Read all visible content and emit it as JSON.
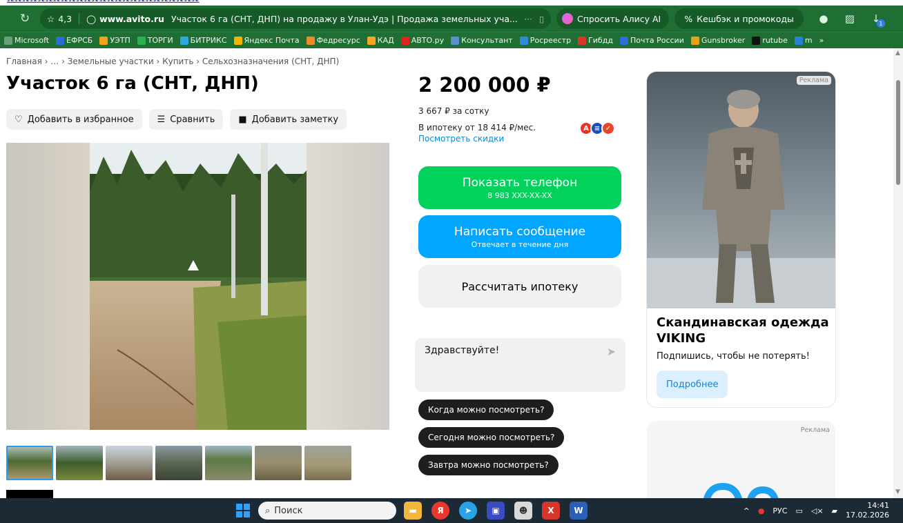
{
  "top_strip": {
    "text": "xxxxxxxxxxxxxxxxxxxxxxxxx"
  },
  "browser": {
    "rating": "4,3",
    "domain": "www.avito.ru",
    "tab_title": "Участок 6 га (СНТ, ДНП) на продажу в Улан-Удэ | Продажа земельных уча...",
    "more": "···",
    "alisa_label": "Спросить Алису AI",
    "cashback_label": "Кешбэк и промокоды",
    "download_badge": "1"
  },
  "bookmarks": [
    {
      "label": "Microsoft",
      "color": "#6b9f77"
    },
    {
      "label": "ЕФРСБ",
      "color": "#2f6bd6"
    },
    {
      "label": "УЭТП",
      "color": "#f3a31b"
    },
    {
      "label": "ТОРГИ",
      "color": "#2bb24c"
    },
    {
      "label": "БИТРИКС",
      "color": "#2aa8e0"
    },
    {
      "label": "Яндекс Почта",
      "color": "#f5b400"
    },
    {
      "label": "Федресурс",
      "color": "#f08a24"
    },
    {
      "label": "КАД",
      "color": "#f5a623"
    },
    {
      "label": "АВТО.ру",
      "color": "#e2231a"
    },
    {
      "label": "Консультант",
      "color": "#5a8fd8"
    },
    {
      "label": "Росреестр",
      "color": "#2f8ad8"
    },
    {
      "label": "Гибдд",
      "color": "#d8352a"
    },
    {
      "label": "Почта России",
      "color": "#2a6fd6"
    },
    {
      "label": "Gunsbroker",
      "color": "#e8a11a"
    },
    {
      "label": "rutube",
      "color": "#111111"
    },
    {
      "label": "m",
      "color": "#2a7fd8"
    }
  ],
  "bookmarks_more": "»",
  "page": {
    "breadcrumb": "Главная › … › Земельные участки › Купить › Сельхозназначения (СНТ, ДНП)",
    "title": "Участок 6 га (СНТ, ДНП)",
    "actions": {
      "favorite": "Добавить в избранное",
      "compare": "Сравнить",
      "note": "Добавить заметку"
    },
    "price": "2 200 000 ₽",
    "per_sotka": "3 667 ₽ за сотку",
    "mortgage": "В ипотеку от 18 414 ₽/мес.",
    "discounts_link": "Посмотреть скидки",
    "phone_btn": {
      "label": "Показать телефон",
      "sub": "8 983 XXX-XX-XX"
    },
    "msg_btn": {
      "label": "Написать сообщение",
      "sub": "Отвечает в течение дня"
    },
    "calc_btn": "Рассчитать ипотеку",
    "chat": {
      "input_value": "Здравствуйте!",
      "chips": [
        "Когда можно посмотреть?",
        "Сегодня можно посмотреть?",
        "Завтра можно посмотреть?"
      ]
    }
  },
  "ad": {
    "badge": "Реклама",
    "title": "Скандинавская одежда VIKING",
    "subtitle": "Подпишись, чтобы не потерять!",
    "button": "Подробнее",
    "badge2": "Реклама"
  },
  "taskbar": {
    "search_placeholder": "Поиск",
    "lang": "РУС",
    "time": "14:41",
    "date": "17.02.2026"
  },
  "colors": {
    "browser_green": "#1f6e33",
    "phone_btn": "#02d15c",
    "msg_btn": "#00a6ff",
    "link": "#0a8ad8"
  }
}
